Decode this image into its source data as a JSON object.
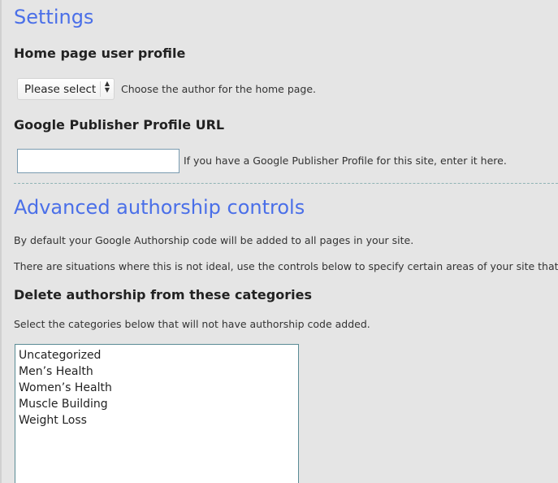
{
  "settings": {
    "heading": "Settings",
    "home_profile": {
      "label": "Home page user profile",
      "select_value": "Please select",
      "description": "Choose the author for the home page."
    },
    "publisher": {
      "label": "Google Publisher Profile URL",
      "input_value": "",
      "description": "If you have a Google Publisher Profile for this site, enter it here."
    }
  },
  "advanced": {
    "heading": "Advanced authorship controls",
    "intro_1": "By default your Google Authorship code will be added to all pages in your site.",
    "intro_2": "There are situations where this is not ideal, use the controls below to specify certain areas of your site that will not",
    "categories": {
      "label": "Delete authorship from these categories",
      "description": "Select the categories below that will not have authorship code added.",
      "options": [
        "Uncategorized",
        "Men’s Health",
        "Women’s Health",
        "Muscle Building",
        "Weight Loss"
      ]
    }
  },
  "colors": {
    "heading": "#4a6fe8",
    "background": "#e5e5e5",
    "divider": "#8fb3b5"
  },
  "icons": {
    "select_arrows": "up-down-arrows-icon"
  }
}
